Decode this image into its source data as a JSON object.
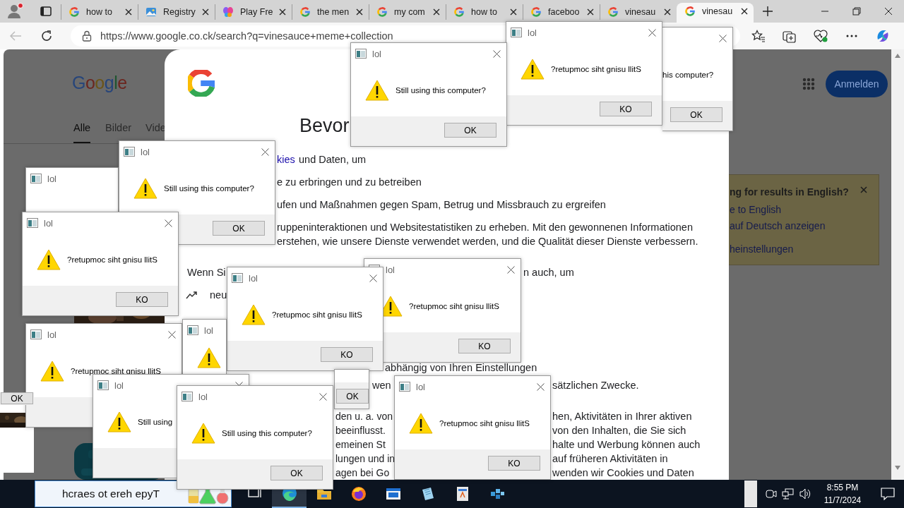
{
  "browser": {
    "tabs": [
      {
        "title": "how to",
        "selected": false
      },
      {
        "title": "Registry",
        "selected": false
      },
      {
        "title": "Play Fre",
        "selected": false
      },
      {
        "title": "the men",
        "selected": false
      },
      {
        "title": "my com",
        "selected": false
      },
      {
        "title": "how to",
        "selected": false
      },
      {
        "title": "faceboo",
        "selected": false
      },
      {
        "title": "vinesau",
        "selected": false
      },
      {
        "title": "vinesau",
        "selected": true
      }
    ],
    "url": "https://www.google.co.ck/search?q=vinesauce+meme+collection"
  },
  "results_page": {
    "logo": "Google",
    "tabs": [
      {
        "label": "Alle",
        "selected": true
      },
      {
        "label": "Bilder",
        "selected": false
      },
      {
        "label": "Vide",
        "selected": false
      }
    ],
    "sign_in": "Anmelden",
    "language_box": {
      "title": "ng for results in English?",
      "links": [
        "e to English",
        "auf Deutsch anzeigen",
        "heinstellungen"
      ]
    }
  },
  "consent": {
    "fragments": [
      {
        "kind": "heading",
        "text": "Bevor"
      },
      {
        "kind": "link",
        "text": "kies"
      },
      {
        "kind": "text",
        "text": "und Daten, um"
      },
      {
        "kind": "text",
        "text": "e zu erbringen und zu betreiben"
      },
      {
        "kind": "text",
        "text": "ufen und Maßnahmen gegen Spam, Betrug und Missbrauch zu ergreifen"
      },
      {
        "kind": "text",
        "text": "ruppeninteraktionen und Websitestatistiken zu erheben. Mit den gewonnenen Informationen"
      },
      {
        "kind": "text",
        "text": "erstehen, wie unsere Dienste verwendet werden, und die Qualität dieser Dienste verbessern."
      },
      {
        "kind": "text",
        "text": "Wenn Si"
      },
      {
        "kind": "text",
        "text": "n auch, um"
      },
      {
        "kind": "text",
        "text": "neu"
      },
      {
        "kind": "text",
        "text": "abhängig von Ihren Einstellungen"
      },
      {
        "kind": "text",
        "text": "wen"
      },
      {
        "kind": "text",
        "text": "sätzlichen Zwecke."
      },
      {
        "kind": "text",
        "text": "den u. a. von"
      },
      {
        "kind": "text",
        "text": "beeinflusst."
      },
      {
        "kind": "text",
        "text": "emeinen St"
      },
      {
        "kind": "text",
        "text": "lungen und in"
      },
      {
        "kind": "text",
        "text": "agen bei Go"
      },
      {
        "kind": "text",
        "text": "hen, Aktivitäten in Ihrer aktiven"
      },
      {
        "kind": "text",
        "text": "von den Inhalten, die Sie sich"
      },
      {
        "kind": "text",
        "text": "halte und Werbung können auch"
      },
      {
        "kind": "text",
        "text": "auf früheren Aktivitäten in"
      },
      {
        "kind": "text",
        "text": "wenden wir Cookies und Daten"
      }
    ]
  },
  "dialogs": [
    {
      "message": "his computer?",
      "button": "OK"
    },
    {
      "title": "lol",
      "message": "?retupmoc siht gnisu llitS",
      "button": "KO"
    },
    {
      "title": "lol",
      "message": "Still using this computer?",
      "button": "OK"
    },
    {
      "title": "lol"
    },
    {
      "title": "lol",
      "message": "Still using this computer?",
      "button": "OK"
    },
    {
      "title": "lol",
      "message": "?retupmoc siht gnisu llitS",
      "button": "KO"
    },
    {
      "title": "lol",
      "message": "?retupmoc siht gnisu llitS",
      "button": "KO"
    },
    {
      "title": "lol",
      "message": "?retupmoc siht gnisu llitS",
      "button": "KO"
    },
    {
      "title": "lol",
      "message": "?retupmoc siht gnisu llitS"
    },
    {
      "title": "lol"
    },
    {
      "button": "OK"
    },
    {
      "title": "lol",
      "message": "Still using"
    },
    {
      "title": "lol",
      "message": "Still using this computer?",
      "button": "OK"
    },
    {
      "title": "lol",
      "message": "?retupmoc siht gnisu llitS",
      "button": "KO"
    },
    {
      "button": "OK"
    }
  ],
  "taskbar": {
    "search_placeholder": "hcraes ot ereh epyT",
    "time": "8:55 PM",
    "date": "11/7/2024"
  }
}
